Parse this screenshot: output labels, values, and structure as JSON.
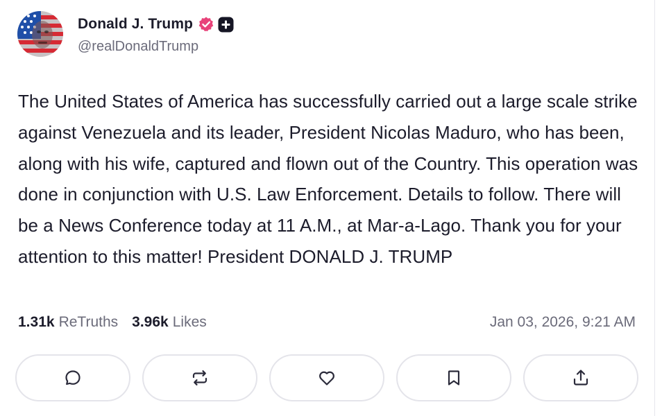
{
  "author": {
    "display_name": "Donald J. Trump",
    "handle": "@realDonaldTrump",
    "verified_icon": "verified-badge-icon",
    "plus_icon": "plus-badge-icon",
    "accent_color": "#e8437a"
  },
  "post": {
    "text": "The United States of America has successfully carried out a large scale strike against Venezuela and its leader, President Nicolas Maduro, who has been, along with his wife, captured and flown out of the Country. This operation was done in conjunction with U.S. Law Enforcement. Details to follow. There will be a News Conference today at 11 A.M., at Mar-a-Lago. Thank you for your attention to this matter! President DONALD J. TRUMP",
    "retruths_count": "1.31k",
    "retruths_label": "ReTruths",
    "likes_count": "3.96k",
    "likes_label": "Likes",
    "timestamp": "Jan 03, 2026, 9:21 AM"
  },
  "actions": [
    {
      "name": "reply",
      "icon": "reply-icon"
    },
    {
      "name": "retruth",
      "icon": "retruth-icon"
    },
    {
      "name": "like",
      "icon": "heart-icon"
    },
    {
      "name": "bookmark",
      "icon": "bookmark-icon"
    },
    {
      "name": "share",
      "icon": "share-icon"
    }
  ]
}
